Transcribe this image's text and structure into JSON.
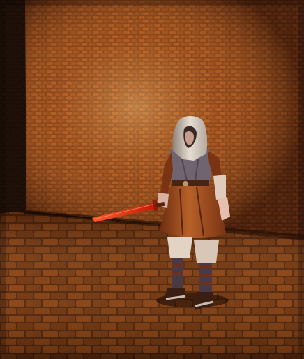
{
  "scene": {
    "type": "3d-game-viewport",
    "environment": "brick-dungeon-room",
    "colors": {
      "wall_dark": "#2a1208",
      "wall_mid": "#6b3416",
      "wall_light": "#c06a2a",
      "wall_highlight": "#e89a4a",
      "floor_dark": "#2a1206",
      "floor_mid": "#5c2c10",
      "floor_light": "#a85a22",
      "shadow_wall": "#0c0603",
      "cloak": "#d8cfc6",
      "tunic_brown": "#8a3e18",
      "tunic_light": "#b8622a",
      "vest_gray": "#6f6470",
      "skin": "#e7bfae",
      "boot": "#3a1e12",
      "sword_blade": "#d42a10",
      "sword_glow": "#ff4a1a"
    },
    "character": {
      "name": "hooded-swordsman",
      "weapon": "red-sword",
      "pose": "idle-standing"
    }
  }
}
